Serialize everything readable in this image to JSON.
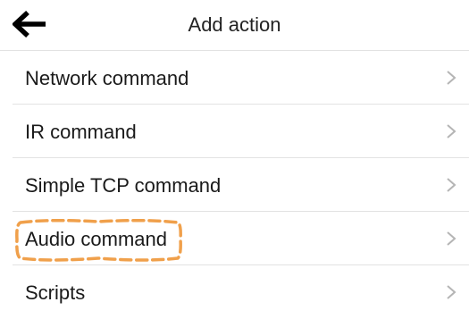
{
  "header": {
    "title": "Add action",
    "back_icon": "arrow-left-icon"
  },
  "actions": [
    {
      "label": "Network command",
      "icon": "chevron-right-icon"
    },
    {
      "label": "IR command",
      "icon": "chevron-right-icon"
    },
    {
      "label": "Simple TCP command",
      "icon": "chevron-right-icon"
    },
    {
      "label": "Audio command",
      "icon": "chevron-right-icon",
      "highlighted": true
    },
    {
      "label": "Scripts",
      "icon": "chevron-right-icon"
    }
  ],
  "colors": {
    "highlight_outline": "#f0a04b",
    "chevron": "#b5b5b5",
    "divider": "#e2e2e2",
    "text": "#1a1a1a"
  }
}
